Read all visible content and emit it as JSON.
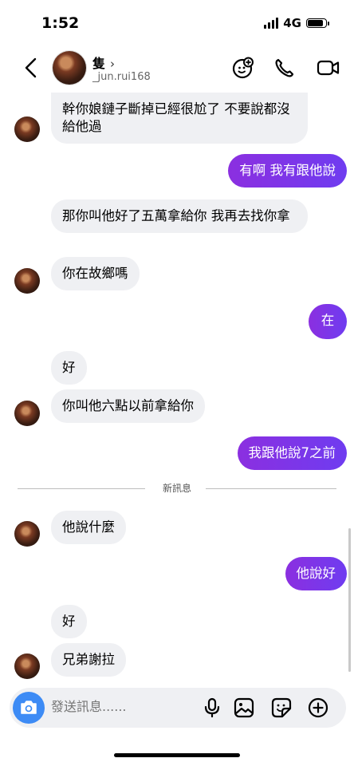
{
  "status": {
    "time": "1:52",
    "network": "4G",
    "battery_level": 0.85
  },
  "header": {
    "name": "隻",
    "chevron": "›",
    "username": "_jun.rui168",
    "icons": [
      "back-chevron-icon",
      "sticker-add-icon",
      "phone-icon",
      "video-camera-icon"
    ]
  },
  "messages": [
    {
      "dir": "in",
      "text": "幹你娘鏈子斷掉已經很尬了 不要說都沒給他過"
    },
    {
      "dir": "out",
      "text": "有啊 我有跟他說"
    },
    {
      "dir": "in",
      "text": "那你叫他好了五萬拿給你 我再去找你拿"
    },
    {
      "dir": "in",
      "text": "你在故鄉嗎"
    },
    {
      "dir": "out",
      "text": "在"
    },
    {
      "dir": "in",
      "text": "好"
    },
    {
      "dir": "in",
      "text": "你叫他六點以前拿給你"
    },
    {
      "dir": "out",
      "text": "我跟他說7之前"
    },
    {
      "dir": "in",
      "text": "他說什麼"
    },
    {
      "dir": "out",
      "text": "他說好"
    },
    {
      "dir": "in",
      "text": "好"
    },
    {
      "dir": "in",
      "text": "兄弟謝拉"
    }
  ],
  "divider": {
    "label": "新訊息"
  },
  "composer": {
    "placeholder": "發送訊息......",
    "icons": [
      "camera-icon",
      "microphone-icon",
      "image-icon",
      "sticker-icon",
      "add-icon"
    ]
  },
  "colors": {
    "outgoing": "#7c3aed",
    "incoming": "#eff0f3",
    "camera": "#3d8bf5"
  }
}
